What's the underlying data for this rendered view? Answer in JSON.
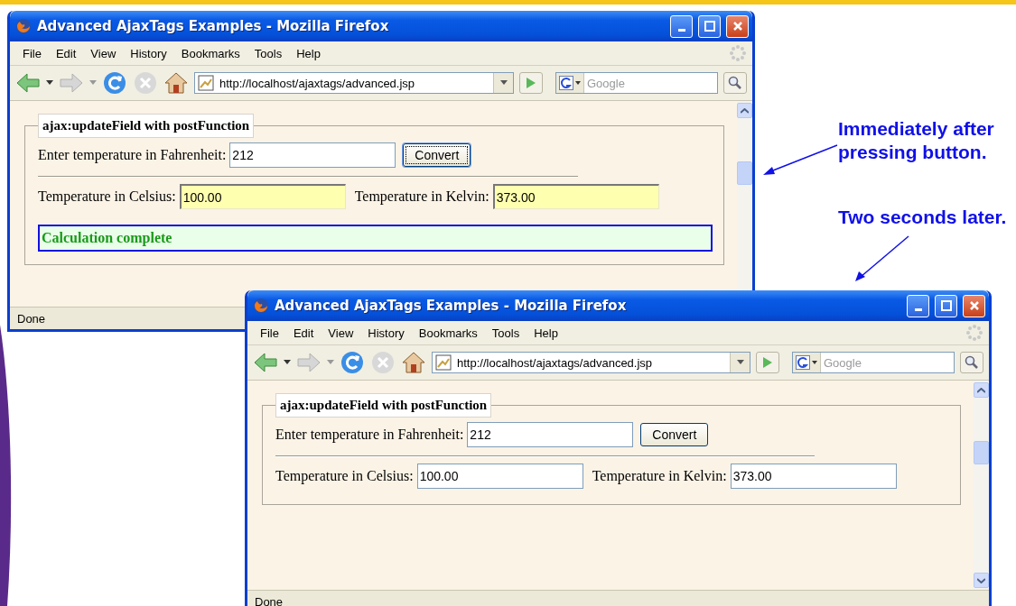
{
  "windows": [
    {
      "title": "Advanced AjaxTags Examples - Mozilla Firefox",
      "menu": [
        "File",
        "Edit",
        "View",
        "History",
        "Bookmarks",
        "Tools",
        "Help"
      ],
      "address": "http://localhost/ajaxtags/advanced.jsp",
      "search": {
        "placeholder": "Google"
      },
      "legend": "ajax:updateField with postFunction",
      "input_label": "Enter temperature in Fahrenheit:",
      "input_value": "212",
      "button": {
        "label": "Convert",
        "focused": true
      },
      "outputs": [
        {
          "label": "Temperature in Celsius:",
          "value": "100.00",
          "highlighted": true
        },
        {
          "label": "Temperature in Kelvin:",
          "value": "373.00",
          "highlighted": true
        }
      ],
      "message": "Calculation complete",
      "status": "Done"
    },
    {
      "title": "Advanced AjaxTags Examples - Mozilla Firefox",
      "menu": [
        "File",
        "Edit",
        "View",
        "History",
        "Bookmarks",
        "Tools",
        "Help"
      ],
      "address": "http://localhost/ajaxtags/advanced.jsp",
      "search": {
        "placeholder": "Google"
      },
      "legend": "ajax:updateField with postFunction",
      "input_label": "Enter temperature in Fahrenheit:",
      "input_value": "212",
      "button": {
        "label": "Convert",
        "focused": false
      },
      "outputs": [
        {
          "label": "Temperature in Celsius:",
          "value": "100.00",
          "highlighted": false
        },
        {
          "label": "Temperature in Kelvin:",
          "value": "373.00",
          "highlighted": false
        }
      ],
      "status": "Done"
    }
  ],
  "callouts": [
    "Immediately after pressing button.",
    "Two seconds later."
  ]
}
